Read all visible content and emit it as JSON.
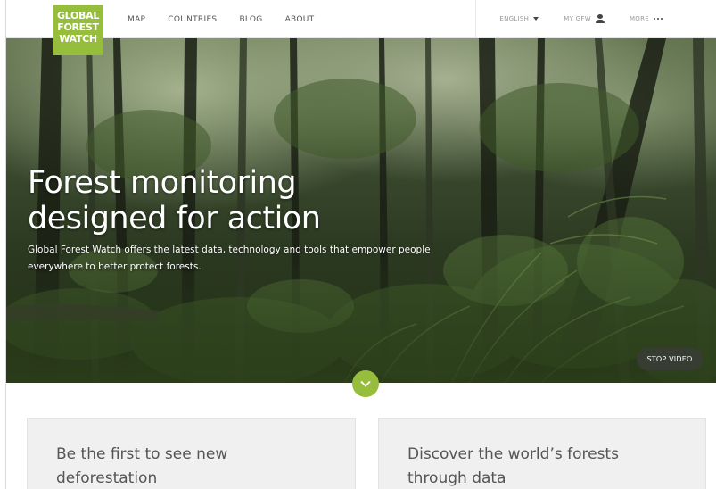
{
  "header": {
    "logo_lines": [
      "GLOBAL",
      "FOREST",
      "WATCH"
    ],
    "nav_left": [
      "MAP",
      "COUNTRIES",
      "BLOG",
      "ABOUT"
    ],
    "language": "ENGLISH",
    "my_gfw": "MY GFW",
    "more": "MORE",
    "icons": {
      "language": "caret-down-icon",
      "my_gfw": "user-icon",
      "more": "more-dots-icon"
    }
  },
  "hero": {
    "title_lines": [
      "Forest monitoring",
      "designed for action"
    ],
    "description": "Global Forest Watch offers the latest data, technology and tools that empower people everywhere to better protect forests.",
    "stop_video": "STOP VIDEO",
    "scroll_icon": "chevron-down-icon"
  },
  "cards": [
    {
      "title": "Be the first to see new deforestation"
    },
    {
      "title": "Discover the world’s forests through data"
    }
  ],
  "colors": {
    "brand_green": "#97bd3d",
    "card_bg": "#f0f0f0",
    "card_text": "#555555"
  }
}
